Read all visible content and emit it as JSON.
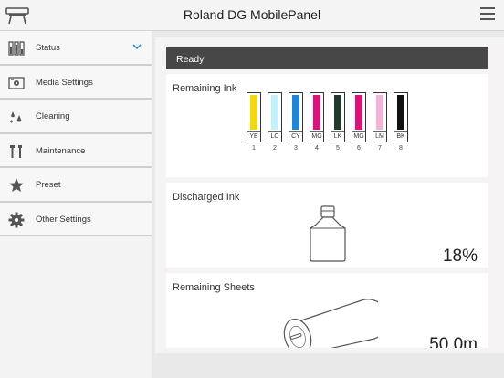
{
  "app": {
    "title": "Roland DG MobilePanel"
  },
  "sidebar": {
    "items": [
      {
        "id": "status",
        "label": "Status",
        "icon": "ink-cartridges-icon",
        "active": true
      },
      {
        "id": "media-settings",
        "label": "Media Settings",
        "icon": "media-settings-icon"
      },
      {
        "id": "cleaning",
        "label": "Cleaning",
        "icon": "cleaning-drops-icon"
      },
      {
        "id": "maintenance",
        "label": "Maintenance",
        "icon": "tools-icon"
      },
      {
        "id": "preset",
        "label": "Preset",
        "icon": "star-icon"
      },
      {
        "id": "other-settings",
        "label": "Other Settings",
        "icon": "gear-icon"
      }
    ]
  },
  "status": {
    "text": "Ready"
  },
  "remaining_ink": {
    "title": "Remaining Ink",
    "cartridges": [
      {
        "code": "YE",
        "num": "1",
        "color": "#f2d90f"
      },
      {
        "code": "LC",
        "num": "2",
        "color": "#bff3fb"
      },
      {
        "code": "CY",
        "num": "3",
        "color": "#1e86d8"
      },
      {
        "code": "MG",
        "num": "4",
        "color": "#e0107a"
      },
      {
        "code": "LK",
        "num": "5",
        "color": "#1f3a2c"
      },
      {
        "code": "MG",
        "num": "6",
        "color": "#e0107a"
      },
      {
        "code": "LM",
        "num": "7",
        "color": "#f2b5d6"
      },
      {
        "code": "BK",
        "num": "8",
        "color": "#111111"
      }
    ]
  },
  "discharged_ink": {
    "title": "Discharged Ink",
    "percent": "18%"
  },
  "remaining_sheets": {
    "title": "Remaining Sheets",
    "value": "50.0m"
  },
  "colors": {
    "status_bar": "#474747",
    "accent": "#1a8ad0"
  }
}
